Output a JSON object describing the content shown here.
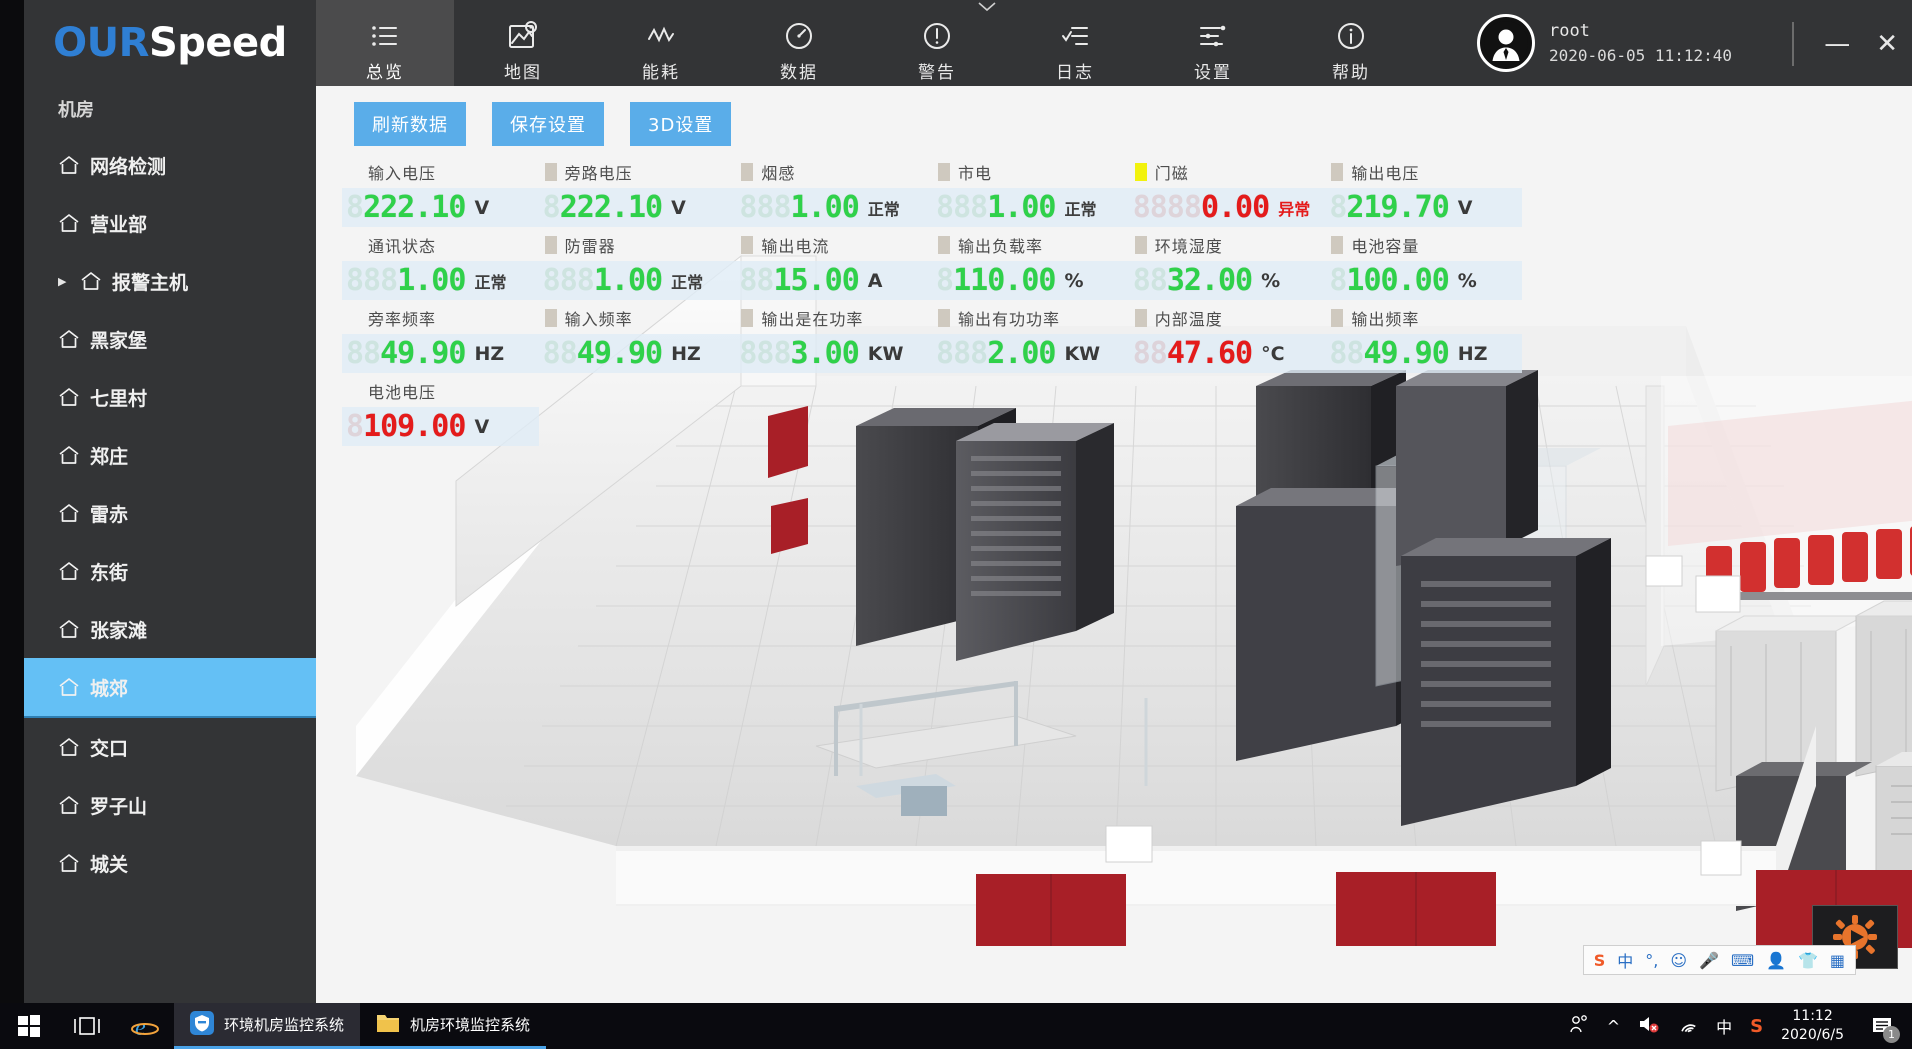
{
  "brand": {
    "part1": "OUR",
    "part2": "Speed"
  },
  "sidebar": {
    "heading": "机房",
    "items": [
      {
        "label": "网络检测",
        "expandable": false,
        "active": false
      },
      {
        "label": "营业部",
        "expandable": false,
        "active": false
      },
      {
        "label": "报警主机",
        "expandable": true,
        "active": false
      },
      {
        "label": "黑家堡",
        "expandable": false,
        "active": false
      },
      {
        "label": "七里村",
        "expandable": false,
        "active": false
      },
      {
        "label": "郑庄",
        "expandable": false,
        "active": false
      },
      {
        "label": "雷赤",
        "expandable": false,
        "active": false
      },
      {
        "label": "东街",
        "expandable": false,
        "active": false
      },
      {
        "label": "张家滩",
        "expandable": false,
        "active": false
      },
      {
        "label": "城郊",
        "expandable": false,
        "active": true
      },
      {
        "label": "交口",
        "expandable": false,
        "active": false
      },
      {
        "label": "罗子山",
        "expandable": false,
        "active": false
      },
      {
        "label": "城关",
        "expandable": false,
        "active": false
      }
    ]
  },
  "topbar": {
    "tabs": [
      {
        "label": "总览",
        "icon": "list-icon",
        "active": true
      },
      {
        "label": "地图",
        "icon": "map-image-icon",
        "active": false
      },
      {
        "label": "能耗",
        "icon": "zigzag-icon",
        "active": false
      },
      {
        "label": "数据",
        "icon": "gauge-icon",
        "active": false
      },
      {
        "label": "警告",
        "icon": "exclamation-circle-icon",
        "active": false
      },
      {
        "label": "日志",
        "icon": "checklist-icon",
        "active": false
      },
      {
        "label": "设置",
        "icon": "sliders-icon",
        "active": false
      },
      {
        "label": "帮助",
        "icon": "info-circle-icon",
        "active": false
      }
    ],
    "user": {
      "name": "root",
      "datetime": "2020-06-05  11:12:40"
    },
    "window_controls": {
      "minimize": "—",
      "close": "✕"
    }
  },
  "toolbar": {
    "buttons": [
      {
        "label": "刷新数据"
      },
      {
        "label": "保存设置"
      },
      {
        "label": "3D设置"
      }
    ]
  },
  "metrics": {
    "rows": [
      [
        {
          "label": "输入电压",
          "ghost": "8",
          "value": "222.10",
          "unit": "V",
          "state": "normal",
          "marker": "none"
        },
        {
          "label": "旁路电压",
          "ghost": "8",
          "value": "222.10",
          "unit": "V",
          "state": "normal",
          "marker": "gray"
        },
        {
          "label": "烟感",
          "ghost": "888",
          "value": "1.00",
          "unit": "正常",
          "state": "normal",
          "marker": "gray"
        },
        {
          "label": "市电",
          "ghost": "888",
          "value": "1.00",
          "unit": "正常",
          "state": "normal",
          "marker": "gray"
        },
        {
          "label": "门磁",
          "ghost": "8888",
          "value": "0.00",
          "unit": "异常",
          "state": "alarm",
          "marker": "yellow"
        },
        {
          "label": "输出电压",
          "ghost": "8",
          "value": "219.70",
          "unit": "V",
          "state": "normal",
          "marker": "gray"
        }
      ],
      [
        {
          "label": "通讯状态",
          "ghost": "888",
          "value": "1.00",
          "unit": "正常",
          "state": "normal",
          "marker": "none"
        },
        {
          "label": "防雷器",
          "ghost": "888",
          "value": "1.00",
          "unit": "正常",
          "state": "normal",
          "marker": "gray"
        },
        {
          "label": "输出电流",
          "ghost": "88",
          "value": "15.00",
          "unit": "A",
          "state": "normal",
          "marker": "gray"
        },
        {
          "label": "输出负载率",
          "ghost": "8",
          "value": "110.00",
          "unit": "%",
          "state": "normal",
          "marker": "gray"
        },
        {
          "label": "环境湿度",
          "ghost": "88",
          "value": "32.00",
          "unit": "%",
          "state": "normal",
          "marker": "gray"
        },
        {
          "label": "电池容量",
          "ghost": "8",
          "value": "100.00",
          "unit": "%",
          "state": "normal",
          "marker": "gray"
        }
      ],
      [
        {
          "label": "旁率频率",
          "ghost": "88",
          "value": "49.90",
          "unit": "HZ",
          "state": "normal",
          "marker": "none"
        },
        {
          "label": "输入频率",
          "ghost": "88",
          "value": "49.90",
          "unit": "HZ",
          "state": "normal",
          "marker": "gray"
        },
        {
          "label": "输出是在功率",
          "ghost": "888",
          "value": "3.00",
          "unit": "KW",
          "state": "normal",
          "marker": "gray"
        },
        {
          "label": "输出有功功率",
          "ghost": "888",
          "value": "2.00",
          "unit": "KW",
          "state": "normal",
          "marker": "gray"
        },
        {
          "label": "内部温度",
          "ghost": "88",
          "value": "47.60",
          "unit": "°C",
          "state": "alarm",
          "marker": "gray"
        },
        {
          "label": "输出频率",
          "ghost": "88",
          "value": "49.90",
          "unit": "HZ",
          "state": "normal",
          "marker": "gray"
        }
      ],
      [
        {
          "label": "电池电压",
          "ghost": "8",
          "value": "109.00",
          "unit": "V",
          "state": "alarm",
          "marker": "none"
        }
      ]
    ]
  },
  "ime": {
    "icons": [
      "sogou-logo-icon",
      "chinese-mode-icon",
      "punctuation-icon",
      "emoji-icon",
      "microphone-icon",
      "keyboard-icon",
      "user-icon",
      "skin-icon",
      "apps-icon"
    ],
    "chinese_glyph": "中"
  },
  "taskbar": {
    "start": "windows-start-icon",
    "taskview": "task-view-icon",
    "items": [
      {
        "label": "环境机房监控系统",
        "icon": "shield-app-icon",
        "active": true
      },
      {
        "label": "机房环境监控系统",
        "icon": "folder-icon",
        "active": false
      }
    ],
    "tray": {
      "people": "people-icon",
      "chevron": "^",
      "volume": "volume-muted-icon",
      "wifi": "wifi-icon",
      "ime": "中",
      "sogou": "sogou-icon",
      "time": "11:12",
      "date": "2020/6/5",
      "notifications": "1"
    }
  },
  "colors": {
    "accent": "#5aade9",
    "sidebar_bg": "#333436",
    "active_item": "#64c0f5",
    "led_green": "#2fd14a",
    "led_red": "#e41b1b",
    "marker_yellow": "#f2f20d"
  }
}
